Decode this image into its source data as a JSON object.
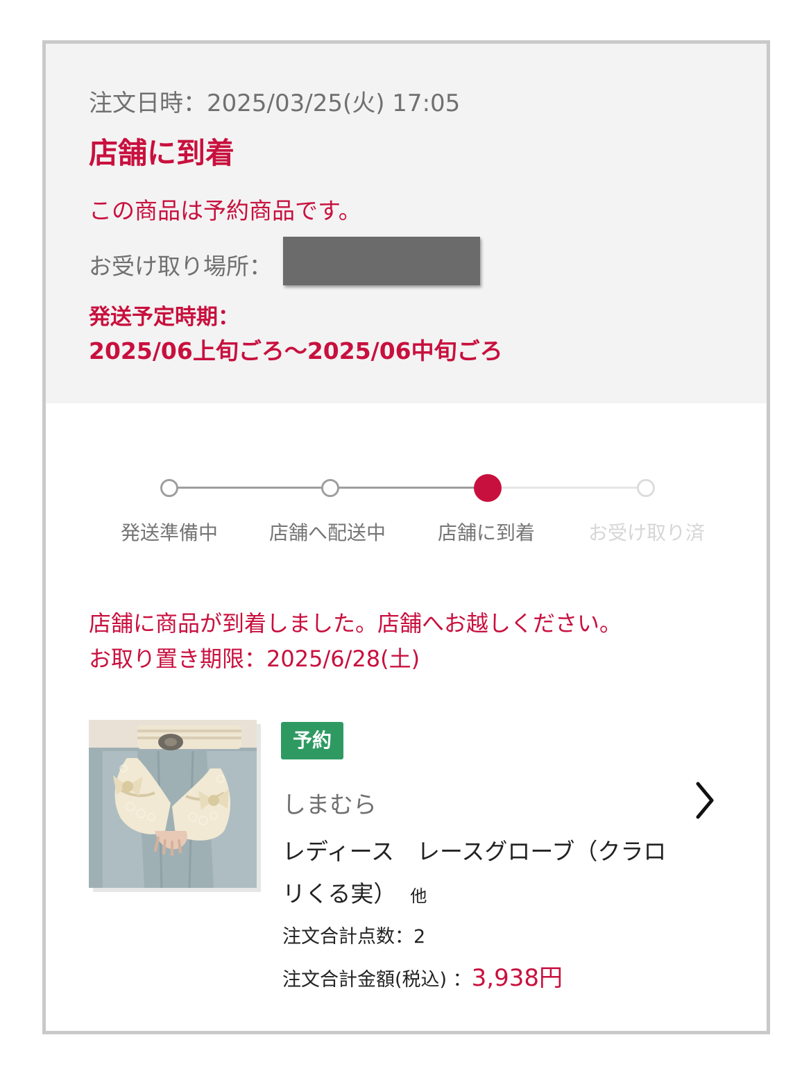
{
  "order": {
    "date_label": "注文日時：",
    "date_value": "2025/03/25(火) 17:05",
    "status_title": "店舗に到着",
    "preorder_note": "この商品は予約商品です。",
    "pickup_label": "お受け取り場所：",
    "ship_label": "発送予定時期：",
    "ship_value": "2025/06上旬ごろ〜2025/06中旬ごろ"
  },
  "progress": {
    "steps": [
      {
        "label": "発送準備中",
        "state": "passed"
      },
      {
        "label": "店舗へ配送中",
        "state": "passed"
      },
      {
        "label": "店舗に到着",
        "state": "current"
      },
      {
        "label": "お受け取り済",
        "state": "future"
      }
    ],
    "colors": {
      "accent": "#c8103e",
      "passed": "#9e9e9e",
      "future": "#dcdcdc"
    }
  },
  "notice": {
    "line1": "店舗に商品が到着しました。店舗へお越しください。",
    "line2_label": "お取り置き期限：",
    "line2_value": "2025/6/28(土)"
  },
  "product": {
    "badge": "予約",
    "shop": "しまむら",
    "name": "レディース　レースグローブ（クラロリくる実）",
    "others": "他",
    "count_label": "注文合計点数：",
    "count_value": "2",
    "total_label": "注文合計金額(税込)",
    "total_sep": "：",
    "total_value": "3,938円",
    "image_icon": "lace-gloves-photo",
    "chevron_icon": "chevron-right-icon"
  },
  "colors": {
    "accent": "#c8103e",
    "badge": "#2e9a62",
    "header_bg": "#f3f3f3",
    "border": "#c9c9c9"
  }
}
